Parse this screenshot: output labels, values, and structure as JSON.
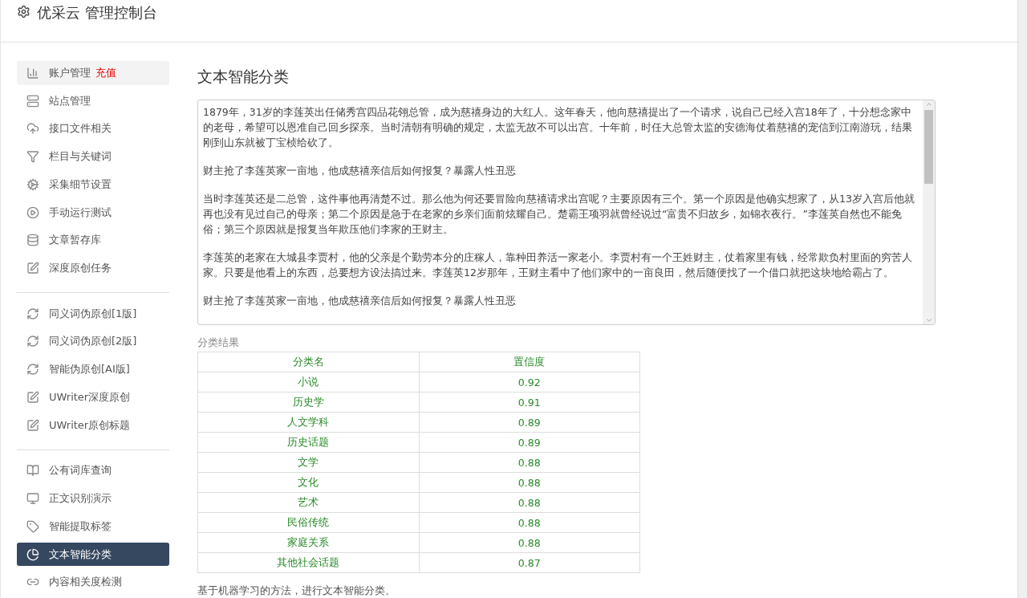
{
  "header": {
    "title": "优采云 管理控制台"
  },
  "sidebar": {
    "groups": [
      {
        "items": [
          {
            "kind": "chart",
            "label": "账户管理",
            "badge": "充值",
            "selected": false,
            "hover": true
          },
          {
            "kind": "server",
            "label": "站点管理",
            "selected": false
          },
          {
            "kind": "cloud",
            "label": "接口文件相关",
            "selected": false
          },
          {
            "kind": "filter",
            "label": "栏目与关键词",
            "selected": false
          },
          {
            "kind": "cogs",
            "label": "采集细节设置",
            "selected": false
          },
          {
            "kind": "play",
            "label": "手动运行测试",
            "selected": false
          },
          {
            "kind": "database",
            "label": "文章暂存库",
            "selected": false
          },
          {
            "kind": "edit",
            "label": "深度原创任务",
            "selected": false
          }
        ]
      },
      {
        "items": [
          {
            "kind": "refresh",
            "label": "同义词伪原创[1版]",
            "selected": false
          },
          {
            "kind": "refresh",
            "label": "同义词伪原创[2版]",
            "selected": false
          },
          {
            "kind": "refresh",
            "label": "智能伪原创[AI版]",
            "selected": false
          },
          {
            "kind": "edit",
            "label": "UWriter深度原创",
            "selected": false
          },
          {
            "kind": "edit",
            "label": "UWriter原创标题",
            "selected": false
          }
        ]
      },
      {
        "items": [
          {
            "kind": "book",
            "label": "公有词库查询",
            "selected": false
          },
          {
            "kind": "monitor",
            "label": "正文识别演示",
            "selected": false
          },
          {
            "kind": "tag",
            "label": "智能提取标签",
            "selected": false
          },
          {
            "kind": "pie",
            "label": "文本智能分类",
            "selected": true
          },
          {
            "kind": "link",
            "label": "内容相关度检测",
            "selected": false
          }
        ]
      }
    ]
  },
  "main": {
    "title": "文本智能分类",
    "input": {
      "paragraphs": [
        "1879年，31岁的李莲英出任储秀宫四品花翎总管，成为慈禧身边的大红人。这年春天，他向慈禧提出了一个请求，说自己已经入宫18年了，十分想念家中的老母，希望可以恩准自己回乡探亲。当时清朝有明确的规定，太监无故不可以出宫。十年前，时任大总管太监的安德海仗着慈禧的宠信到江南游玩，结果刚到山东就被丁宝桢给砍了。",
        "财主抢了李莲英家一亩地，他成慈禧亲信后如何报复？暴露人性丑恶",
        "当时李莲英还是二总管，这件事他再清楚不过。那么他为何还要冒险向慈禧请求出宫呢？主要原因有三个。第一个原因是他确实想家了，从13岁入宫后他就再也没有见过自己的母亲；第二个原因是急于在老家的乡亲们面前炫耀自己。楚霸王项羽就曾经说过“富贵不归故乡，如锦衣夜行。”李莲英自然也不能免俗；第三个原因就是报复当年欺压他们李家的王财主。",
        "李莲英的老家在大城县李贾村，他的父亲是个勤劳本分的庄稼人，靠种田养活一家老小。李贾村有一个王姓财主，仗着家里有钱，经常欺负村里面的穷苦人家。只要是他看上的东西，总要想方设法搞过来。李莲英12岁那年，王财主看中了他们家中的一亩良田，然后随便找了一个借口就把这块地给霸占了。",
        "财主抢了李莲英家一亩地，他成慈禧亲信后如何报复？暴露人性丑恶"
      ]
    },
    "result_label": "分类结果",
    "table": {
      "columns": [
        "分类名",
        "置信度"
      ],
      "rows": [
        [
          "小说",
          "0.92"
        ],
        [
          "历史学",
          "0.91"
        ],
        [
          "人文学科",
          "0.89"
        ],
        [
          "历史话题",
          "0.89"
        ],
        [
          "文学",
          "0.88"
        ],
        [
          "文化",
          "0.88"
        ],
        [
          "艺术",
          "0.88"
        ],
        [
          "民俗传统",
          "0.88"
        ],
        [
          "家庭关系",
          "0.88"
        ],
        [
          "其他社会话题",
          "0.87"
        ]
      ]
    },
    "note": "基于机器学习的方法，进行文本智能分类。"
  }
}
